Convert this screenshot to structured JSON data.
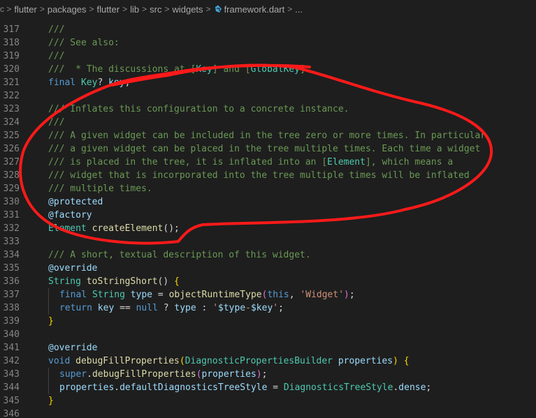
{
  "breadcrumb": {
    "items": [
      "flutter",
      "packages",
      "flutter",
      "lib",
      "src",
      "widgets",
      "framework.dart",
      "..."
    ],
    "lead_glyph": "c >"
  },
  "colors": {
    "comment": "#6a9955",
    "keyword": "#569cd6",
    "type": "#4ec9b0",
    "function": "#dcdcaa",
    "variable": "#9cdcfe",
    "string": "#ce9178",
    "annotation": "#ff1a1a"
  },
  "lines": [
    {
      "n": "317",
      "tokens": [
        {
          "t": "///",
          "c": "c"
        }
      ]
    },
    {
      "n": "318",
      "tokens": [
        {
          "t": "/// See also:",
          "c": "c"
        }
      ]
    },
    {
      "n": "319",
      "tokens": [
        {
          "t": "///",
          "c": "c"
        }
      ]
    },
    {
      "n": "320",
      "tokens": [
        {
          "t": "///  * The discussions at [",
          "c": "c"
        },
        {
          "t": "Key",
          "c": "cb"
        },
        {
          "t": "] and [",
          "c": "c"
        },
        {
          "t": "GlobalKey",
          "c": "cb"
        },
        {
          "t": "].",
          "c": "c"
        }
      ]
    },
    {
      "n": "321",
      "tokens": [
        {
          "t": "final ",
          "c": "kw"
        },
        {
          "t": "Key",
          "c": "ty"
        },
        {
          "t": "? ",
          "c": "pu"
        },
        {
          "t": "key",
          "c": "va"
        },
        {
          "t": ";",
          "c": "pu"
        }
      ]
    },
    {
      "n": "322",
      "tokens": []
    },
    {
      "n": "323",
      "tokens": [
        {
          "t": "/// Inflates this configuration to a concrete instance.",
          "c": "c"
        }
      ]
    },
    {
      "n": "324",
      "tokens": [
        {
          "t": "///",
          "c": "c"
        }
      ]
    },
    {
      "n": "325",
      "tokens": [
        {
          "t": "/// A given widget can be included in the tree zero or more times. In particular",
          "c": "c"
        }
      ]
    },
    {
      "n": "326",
      "tokens": [
        {
          "t": "/// a given widget can be placed in the tree multiple times. Each time a widget",
          "c": "c"
        }
      ]
    },
    {
      "n": "327",
      "tokens": [
        {
          "t": "/// is placed in the tree, it is inflated into an [",
          "c": "c"
        },
        {
          "t": "Element",
          "c": "cb"
        },
        {
          "t": "], which means a",
          "c": "c"
        }
      ]
    },
    {
      "n": "328",
      "tokens": [
        {
          "t": "/// widget that is incorporated into the tree multiple times will be inflated",
          "c": "c"
        }
      ]
    },
    {
      "n": "329",
      "tokens": [
        {
          "t": "/// multiple times.",
          "c": "c"
        }
      ]
    },
    {
      "n": "330",
      "tokens": [
        {
          "t": "@protected",
          "c": "va"
        }
      ]
    },
    {
      "n": "331",
      "tokens": [
        {
          "t": "@factory",
          "c": "va"
        }
      ]
    },
    {
      "n": "332",
      "tokens": [
        {
          "t": "Element ",
          "c": "ty"
        },
        {
          "t": "createElement",
          "c": "fn"
        },
        {
          "t": "();",
          "c": "pu"
        }
      ]
    },
    {
      "n": "333",
      "tokens": []
    },
    {
      "n": "334",
      "tokens": [
        {
          "t": "/// A short, textual description of this widget.",
          "c": "c"
        }
      ]
    },
    {
      "n": "335",
      "tokens": [
        {
          "t": "@override",
          "c": "va"
        }
      ]
    },
    {
      "n": "336",
      "tokens": [
        {
          "t": "String ",
          "c": "ty"
        },
        {
          "t": "toStringShort",
          "c": "fn"
        },
        {
          "t": "() ",
          "c": "pu"
        },
        {
          "t": "{",
          "c": "b2"
        }
      ]
    },
    {
      "n": "337",
      "indent": true,
      "tokens": [
        {
          "t": "final ",
          "c": "kw"
        },
        {
          "t": "String ",
          "c": "ty"
        },
        {
          "t": "type ",
          "c": "va"
        },
        {
          "t": "= ",
          "c": "pu"
        },
        {
          "t": "objectRuntimeType",
          "c": "fn"
        },
        {
          "t": "(",
          "c": "b1"
        },
        {
          "t": "this",
          "c": "kw"
        },
        {
          "t": ", ",
          "c": "pu"
        },
        {
          "t": "'Widget'",
          "c": "st"
        },
        {
          "t": ")",
          "c": "b1"
        },
        {
          "t": ";",
          "c": "pu"
        }
      ]
    },
    {
      "n": "338",
      "indent": true,
      "tokens": [
        {
          "t": "return ",
          "c": "kw"
        },
        {
          "t": "key ",
          "c": "va"
        },
        {
          "t": "== ",
          "c": "pu"
        },
        {
          "t": "null ",
          "c": "kw"
        },
        {
          "t": "? ",
          "c": "pu"
        },
        {
          "t": "type ",
          "c": "va"
        },
        {
          "t": ": ",
          "c": "pu"
        },
        {
          "t": "'",
          "c": "st"
        },
        {
          "t": "$type",
          "c": "va"
        },
        {
          "t": "-",
          "c": "st"
        },
        {
          "t": "$key",
          "c": "va"
        },
        {
          "t": "'",
          "c": "st"
        },
        {
          "t": ";",
          "c": "pu"
        }
      ]
    },
    {
      "n": "339",
      "tokens": [
        {
          "t": "}",
          "c": "b2"
        }
      ]
    },
    {
      "n": "340",
      "tokens": []
    },
    {
      "n": "341",
      "tokens": [
        {
          "t": "@override",
          "c": "va"
        }
      ]
    },
    {
      "n": "342",
      "tokens": [
        {
          "t": "void ",
          "c": "kw"
        },
        {
          "t": "debugFillProperties",
          "c": "fn"
        },
        {
          "t": "(",
          "c": "b2"
        },
        {
          "t": "DiagnosticPropertiesBuilder ",
          "c": "ty"
        },
        {
          "t": "properties",
          "c": "va"
        },
        {
          "t": ") ",
          "c": "b2"
        },
        {
          "t": "{",
          "c": "b2"
        }
      ]
    },
    {
      "n": "343",
      "indent": true,
      "tokens": [
        {
          "t": "super",
          "c": "kw"
        },
        {
          "t": ".",
          "c": "pu"
        },
        {
          "t": "debugFillProperties",
          "c": "fn"
        },
        {
          "t": "(",
          "c": "b1"
        },
        {
          "t": "properties",
          "c": "va"
        },
        {
          "t": ")",
          "c": "b1"
        },
        {
          "t": ";",
          "c": "pu"
        }
      ]
    },
    {
      "n": "344",
      "indent": true,
      "tokens": [
        {
          "t": "properties",
          "c": "va"
        },
        {
          "t": ".",
          "c": "pu"
        },
        {
          "t": "defaultDiagnosticsTreeStyle ",
          "c": "va"
        },
        {
          "t": "= ",
          "c": "pu"
        },
        {
          "t": "DiagnosticsTreeStyle",
          "c": "ty"
        },
        {
          "t": ".",
          "c": "pu"
        },
        {
          "t": "dense",
          "c": "va"
        },
        {
          "t": ";",
          "c": "pu"
        }
      ]
    },
    {
      "n": "345",
      "tokens": [
        {
          "t": "}",
          "c": "b2"
        }
      ]
    },
    {
      "n": "346",
      "tokens": []
    }
  ]
}
